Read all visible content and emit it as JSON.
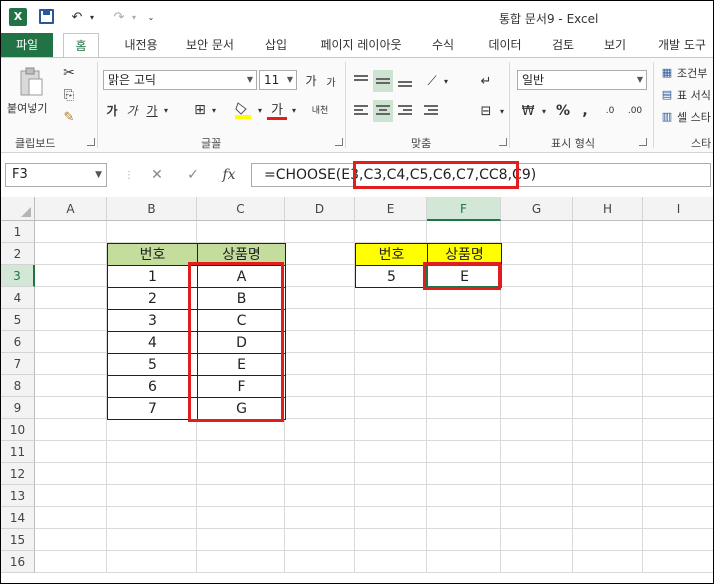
{
  "window": {
    "title": "통합 문서9 - Excel",
    "app_icon": "X"
  },
  "ribbon_tabs": [
    "파일",
    "홈",
    "내전용",
    "보안 문서",
    "삽입",
    "페이지 레이아웃",
    "수식",
    "데이터",
    "검토",
    "보기",
    "개발 도구"
  ],
  "ribbon": {
    "clipboard": {
      "paste_label": "붙여넣기",
      "group_label": "클립보드"
    },
    "font": {
      "font_name": "맑은 고딕",
      "font_size": "11",
      "bold": "가",
      "italic": "가",
      "underline": "가",
      "font_color_glyph": "가",
      "phonetic": "내천",
      "grow": "가",
      "shrink": "가",
      "group_label": "글꼴"
    },
    "alignment": {
      "group_label": "맞춤"
    },
    "number": {
      "format": "일반",
      "percent": "%",
      "comma": ",",
      "inc_decimal": ".0",
      "dec_decimal": ".00",
      "group_label": "표시 형식"
    },
    "styles": {
      "conditional": "조건부",
      "table": "표 서식",
      "cell": "셀 스타",
      "group_label": "스타"
    },
    "accent_color": "#217346"
  },
  "formula_bar": {
    "name_box": "F3",
    "cancel": "✕",
    "enter": "✓",
    "fx": "fx",
    "formula": "=CHOOSE(E3,C3,C4,C5,C6,C7,CC8,C9)"
  },
  "grid": {
    "columns": [
      "A",
      "B",
      "C",
      "D",
      "E",
      "F",
      "G",
      "H",
      "I"
    ],
    "rows": [
      "1",
      "2",
      "3",
      "4",
      "5",
      "6",
      "7",
      "8",
      "9",
      "10",
      "11",
      "12",
      "13",
      "14",
      "15",
      "16"
    ],
    "selected_cell": "F3",
    "table1": {
      "headers": [
        "번호",
        "상품명"
      ],
      "rows": [
        [
          "1",
          "A"
        ],
        [
          "2",
          "B"
        ],
        [
          "3",
          "C"
        ],
        [
          "4",
          "D"
        ],
        [
          "5",
          "E"
        ],
        [
          "6",
          "F"
        ],
        [
          "7",
          "G"
        ]
      ]
    },
    "table2": {
      "headers": [
        "번호",
        "상품명"
      ],
      "row": [
        "5",
        "E"
      ]
    }
  },
  "highlight_color": "#e01e1e"
}
